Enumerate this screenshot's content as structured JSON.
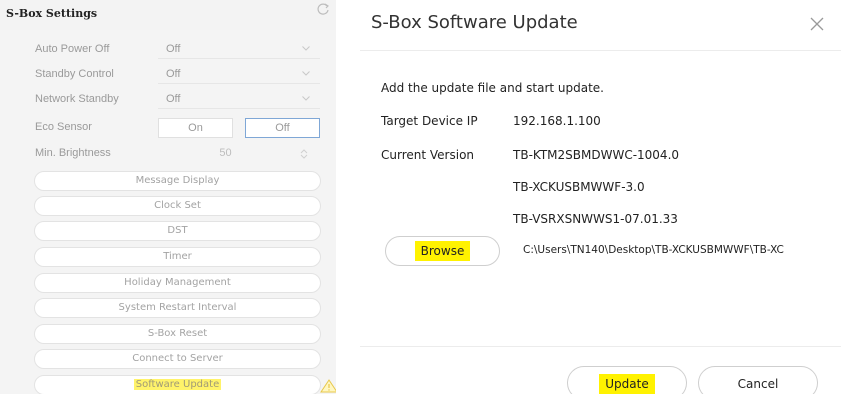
{
  "left_panel": {
    "title": "S-Box Settings",
    "settings": [
      {
        "label": "Auto Power Off",
        "value": "Off"
      },
      {
        "label": "Standby Control",
        "value": "Off"
      },
      {
        "label": "Network Standby",
        "value": "Off"
      }
    ],
    "eco_sensor": {
      "label": "Eco Sensor",
      "on_label": "On",
      "off_label": "Off",
      "selected": "Off"
    },
    "min_brightness": {
      "label": "Min. Brightness",
      "value": "50"
    },
    "buttons": [
      "Message Display",
      "Clock Set",
      "DST",
      "Timer",
      "Holiday Management",
      "System Restart Interval",
      "S-Box Reset",
      "Connect to Server"
    ],
    "software_update_label": "Software Update"
  },
  "dialog": {
    "title": "S-Box Software Update",
    "instruction": "Add the update file and start update.",
    "target_ip_label": "Target Device IP",
    "target_ip_value": "192.168.1.100",
    "current_version_label": "Current Version",
    "versions": [
      "TB-KTM2SBMDWWC-1004.0",
      "TB-XCKUSBMWWF-3.0",
      "TB-VSRXSNWWS1-07.01.33"
    ],
    "browse_label": "Browse",
    "file_path": "C:\\Users\\TN140\\Desktop\\TB-XCKUSBMWWF\\TB-XC",
    "update_label": "Update",
    "cancel_label": "Cancel"
  },
  "colors": {
    "highlight": "#fff200",
    "active_toggle_border": "#7fa7d6",
    "warning": "#e8c84a"
  },
  "icons": {
    "refresh": "refresh-icon",
    "close": "close-icon",
    "warning": "warning-icon",
    "dropdown": "chevron-down-icon",
    "stepper": "stepper-icon"
  }
}
